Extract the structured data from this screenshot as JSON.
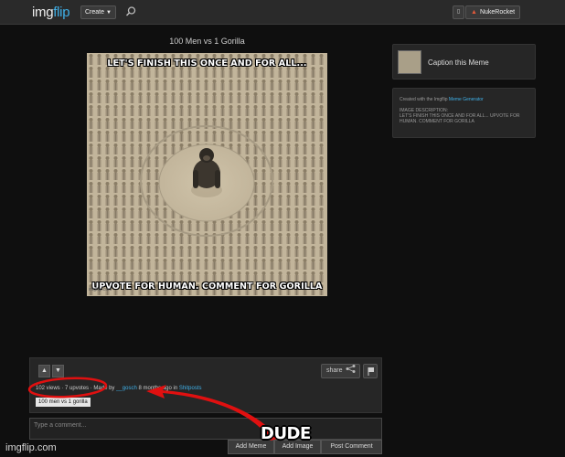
{
  "header": {
    "logo_part1": "img",
    "logo_part2": "flip",
    "create_label": "Create",
    "notifications_icon": "notification-icon",
    "username": "NukeRocket"
  },
  "meme": {
    "title": "100 Men vs 1 Gorilla",
    "top_text": "LET'S FINISH THIS ONCE AND FOR ALL...",
    "bottom_text": "UPVOTE FOR HUMAN. COMMENT FOR GORILLA",
    "watermark": "imgflip.com"
  },
  "sidebar": {
    "caption_label": "Caption this Meme",
    "created_with_prefix": "Created with the Imgflip ",
    "created_with_link": "Meme Generator",
    "description_heading": "IMAGE DESCRIPTION:",
    "description_text": "LET'S FINISH THIS ONCE AND FOR ALL... UPVOTE FOR HUMAN. COMMENT FOR GORILLA"
  },
  "info": {
    "views": "102 views",
    "upvotes": "7 upvotes",
    "made_by_prefix": "Made by ",
    "author": "__gosch",
    "time_ago": "8 months ago",
    "in_word": "in",
    "stream": "Shitposts",
    "tag": "100 men vs 1 gorilla",
    "share_label": "share"
  },
  "comment": {
    "placeholder": "Type a comment...",
    "add_meme": "Add Meme",
    "add_image": "Add Image",
    "post": "Post Comment"
  },
  "footer": {
    "watermark": "imgflip.com"
  },
  "annotation": {
    "text": "DUDE",
    "color": "#e01010"
  }
}
